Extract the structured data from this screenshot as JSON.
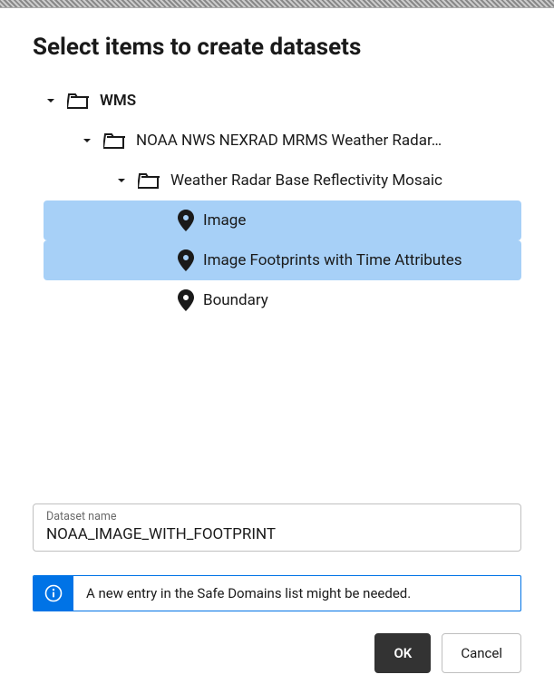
{
  "title": "Select items to create datasets",
  "tree": {
    "root": {
      "label": "WMS"
    },
    "level1": {
      "label": "NOAA NWS NEXRAD MRMS Weather Radar…"
    },
    "level2": {
      "label": "Weather Radar Base Reflectivity Mosaic"
    },
    "leaves": {
      "image": {
        "label": "Image"
      },
      "footprints": {
        "label": "Image Footprints with Time Attributes"
      },
      "boundary": {
        "label": "Boundary"
      }
    }
  },
  "field": {
    "label": "Dataset name",
    "value": "NOAA_IMAGE_WITH_FOOTPRINT"
  },
  "info": {
    "text": "A new entry in the Safe Domains list might be needed."
  },
  "buttons": {
    "ok": "OK",
    "cancel": "Cancel"
  }
}
